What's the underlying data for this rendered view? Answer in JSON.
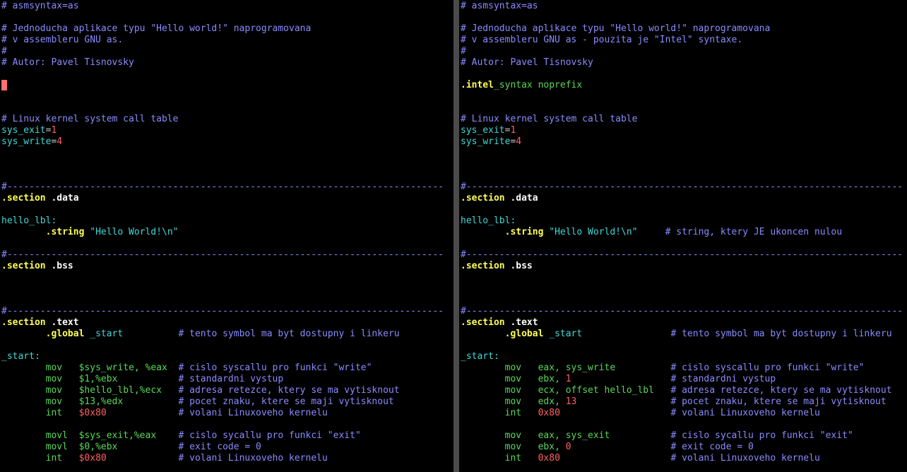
{
  "editor": {
    "left_pane": {
      "lines": [
        [
          [
            "c-comment",
            "# asmsyntax=as"
          ]
        ],
        [],
        [
          [
            "c-comment",
            "# Jednoducha aplikace typu \"Hello world!\" naprogramovana"
          ]
        ],
        [
          [
            "c-comment",
            "# v assembleru GNU as."
          ]
        ],
        [
          [
            "c-comment",
            "#"
          ]
        ],
        [
          [
            "c-comment",
            "# Autor: Pavel Tisnovsky"
          ]
        ],
        [],
        "CURSOR",
        [],
        [],
        [
          [
            "c-comment",
            "# Linux kernel system call table"
          ]
        ],
        [
          [
            "c-label",
            "sys_exit"
          ],
          [
            "c-plain",
            "="
          ],
          [
            "c-number",
            "1"
          ]
        ],
        [
          [
            "c-label",
            "sys_write"
          ],
          [
            "c-plain",
            "="
          ],
          [
            "c-number",
            "4"
          ]
        ],
        [],
        [],
        [],
        [
          [
            "c-comment",
            "#-------------------------------------------------------------------------------"
          ]
        ],
        [
          [
            "c-directive",
            ".section"
          ],
          [
            "c-dirrest",
            " .data"
          ]
        ],
        [],
        [
          [
            "c-label",
            "hello_lbl:"
          ]
        ],
        [
          [
            "c-plain",
            "        "
          ],
          [
            "c-directive",
            ".string"
          ],
          [
            "c-plain",
            " "
          ],
          [
            "c-string",
            "\"Hello World!\\n\""
          ]
        ],
        [],
        [
          [
            "c-comment",
            "#-------------------------------------------------------------------------------"
          ]
        ],
        [
          [
            "c-directive",
            ".section"
          ],
          [
            "c-dirrest",
            " .bss"
          ]
        ],
        [],
        [],
        [],
        [
          [
            "c-comment",
            "#-------------------------------------------------------------------------------"
          ]
        ],
        [
          [
            "c-directive",
            ".section"
          ],
          [
            "c-dirrest",
            " .text"
          ]
        ],
        [
          [
            "c-plain",
            "        "
          ],
          [
            "c-directive",
            ".global"
          ],
          [
            "c-plain",
            " "
          ],
          [
            "c-ident",
            "_start"
          ],
          [
            "c-plain",
            "          "
          ],
          [
            "c-comment",
            "# tento symbol ma byt dostupny i linkeru"
          ]
        ],
        [],
        [
          [
            "c-label",
            "_start:"
          ]
        ],
        [
          [
            "c-plain",
            "        "
          ],
          [
            "c-instr",
            "mov"
          ],
          [
            "c-plain",
            "   "
          ],
          [
            "c-operand",
            "$sys_write, %eax"
          ],
          [
            "c-plain",
            "  "
          ],
          [
            "c-comment",
            "# cislo syscallu pro funkci \"write\""
          ]
        ],
        [
          [
            "c-plain",
            "        "
          ],
          [
            "c-instr",
            "mov"
          ],
          [
            "c-plain",
            "   "
          ],
          [
            "c-operand",
            "$1,%ebx"
          ],
          [
            "c-plain",
            "           "
          ],
          [
            "c-comment",
            "# standardni vystup"
          ]
        ],
        [
          [
            "c-plain",
            "        "
          ],
          [
            "c-instr",
            "mov"
          ],
          [
            "c-plain",
            "   "
          ],
          [
            "c-operand",
            "$hello_lbl,%ecx"
          ],
          [
            "c-plain",
            "   "
          ],
          [
            "c-comment",
            "# adresa retezce, ktery se ma vytisknout"
          ]
        ],
        [
          [
            "c-plain",
            "        "
          ],
          [
            "c-instr",
            "mov"
          ],
          [
            "c-plain",
            "   "
          ],
          [
            "c-operand",
            "$13,%edx"
          ],
          [
            "c-plain",
            "          "
          ],
          [
            "c-comment",
            "# pocet znaku, ktere se maji vytisknout"
          ]
        ],
        [
          [
            "c-plain",
            "        "
          ],
          [
            "c-instr",
            "int"
          ],
          [
            "c-plain",
            "   "
          ],
          [
            "c-imm",
            "$0x80"
          ],
          [
            "c-plain",
            "             "
          ],
          [
            "c-comment",
            "# volani Linuxoveho kernelu"
          ]
        ],
        [],
        [
          [
            "c-plain",
            "        "
          ],
          [
            "c-instr",
            "movl"
          ],
          [
            "c-plain",
            "  "
          ],
          [
            "c-operand",
            "$sys_exit,%eax"
          ],
          [
            "c-plain",
            "    "
          ],
          [
            "c-comment",
            "# cislo sycallu pro funkci \"exit\""
          ]
        ],
        [
          [
            "c-plain",
            "        "
          ],
          [
            "c-instr",
            "movl"
          ],
          [
            "c-plain",
            "  "
          ],
          [
            "c-operand",
            "$0,%ebx"
          ],
          [
            "c-plain",
            "           "
          ],
          [
            "c-comment",
            "# exit code = 0"
          ]
        ],
        [
          [
            "c-plain",
            "        "
          ],
          [
            "c-instr",
            "int"
          ],
          [
            "c-plain",
            "   "
          ],
          [
            "c-imm",
            "$0x80"
          ],
          [
            "c-plain",
            "             "
          ],
          [
            "c-comment",
            "# volani Linuxoveho kernelu"
          ]
        ]
      ]
    },
    "right_pane": {
      "lines": [
        [
          [
            "c-comment",
            "# asmsyntax=as"
          ]
        ],
        [],
        [
          [
            "c-comment",
            "# Jednoducha aplikace typu \"Hello world!\" naprogramovana"
          ]
        ],
        [
          [
            "c-comment",
            "# v assembleru GNU as - pouzita je \"Intel\" syntaxe."
          ]
        ],
        [
          [
            "c-comment",
            "#"
          ]
        ],
        [
          [
            "c-comment",
            "# Autor: Pavel Tisnovsky"
          ]
        ],
        [],
        [
          [
            "c-directive",
            ".intel"
          ],
          [
            "c-instr",
            "_syntax noprefix"
          ]
        ],
        [],
        [],
        [
          [
            "c-comment",
            "# Linux kernel system call table"
          ]
        ],
        [
          [
            "c-label",
            "sys_exit"
          ],
          [
            "c-plain",
            "="
          ],
          [
            "c-number",
            "1"
          ]
        ],
        [
          [
            "c-label",
            "sys_write"
          ],
          [
            "c-plain",
            "="
          ],
          [
            "c-number",
            "4"
          ]
        ],
        [],
        [],
        [],
        [
          [
            "c-comment",
            "#-------------------------------------------------------------------------------"
          ]
        ],
        [
          [
            "c-directive",
            ".section"
          ],
          [
            "c-dirrest",
            " .data"
          ]
        ],
        [],
        [
          [
            "c-label",
            "hello_lbl:"
          ]
        ],
        [
          [
            "c-plain",
            "        "
          ],
          [
            "c-directive",
            ".string"
          ],
          [
            "c-plain",
            " "
          ],
          [
            "c-string",
            "\"Hello World!\\n\""
          ],
          [
            "c-plain",
            "     "
          ],
          [
            "c-comment",
            "# string, ktery JE ukoncen nulou"
          ]
        ],
        [],
        [
          [
            "c-comment",
            "#-------------------------------------------------------------------------------"
          ]
        ],
        [
          [
            "c-directive",
            ".section"
          ],
          [
            "c-dirrest",
            " .bss"
          ]
        ],
        [],
        [],
        [],
        [
          [
            "c-comment",
            "#-------------------------------------------------------------------------------"
          ]
        ],
        [
          [
            "c-directive",
            ".section"
          ],
          [
            "c-dirrest",
            " .text"
          ]
        ],
        [
          [
            "c-plain",
            "        "
          ],
          [
            "c-directive",
            ".global"
          ],
          [
            "c-plain",
            " "
          ],
          [
            "c-ident",
            "_start"
          ],
          [
            "c-plain",
            "                "
          ],
          [
            "c-comment",
            "# tento symbol ma byt dostupny i linkeru"
          ]
        ],
        [],
        [
          [
            "c-label",
            "_start:"
          ]
        ],
        [
          [
            "c-plain",
            "        "
          ],
          [
            "c-instr",
            "mov"
          ],
          [
            "c-plain",
            "   "
          ],
          [
            "c-operand",
            "eax, sys_write"
          ],
          [
            "c-plain",
            "          "
          ],
          [
            "c-comment",
            "# cislo syscallu pro funkci \"write\""
          ]
        ],
        [
          [
            "c-plain",
            "        "
          ],
          [
            "c-instr",
            "mov"
          ],
          [
            "c-plain",
            "   "
          ],
          [
            "c-operand",
            "ebx, "
          ],
          [
            "c-imm",
            "1"
          ],
          [
            "c-plain",
            "                  "
          ],
          [
            "c-comment",
            "# standardni vystup"
          ]
        ],
        [
          [
            "c-plain",
            "        "
          ],
          [
            "c-instr",
            "mov"
          ],
          [
            "c-plain",
            "   "
          ],
          [
            "c-operand",
            "ecx, offset hello_lbl"
          ],
          [
            "c-plain",
            "   "
          ],
          [
            "c-comment",
            "# adresa retezce, ktery se ma vytisknout"
          ]
        ],
        [
          [
            "c-plain",
            "        "
          ],
          [
            "c-instr",
            "mov"
          ],
          [
            "c-plain",
            "   "
          ],
          [
            "c-operand",
            "edx, "
          ],
          [
            "c-imm",
            "13"
          ],
          [
            "c-plain",
            "                 "
          ],
          [
            "c-comment",
            "# pocet znaku, ktere se maji vytisknout"
          ]
        ],
        [
          [
            "c-plain",
            "        "
          ],
          [
            "c-instr",
            "int"
          ],
          [
            "c-plain",
            "   "
          ],
          [
            "c-imm",
            "0x80"
          ],
          [
            "c-plain",
            "                    "
          ],
          [
            "c-comment",
            "# volani Linuxoveho kernelu"
          ]
        ],
        [],
        [
          [
            "c-plain",
            "        "
          ],
          [
            "c-instr",
            "mov"
          ],
          [
            "c-plain",
            "   "
          ],
          [
            "c-operand",
            "eax, sys_exit"
          ],
          [
            "c-plain",
            "           "
          ],
          [
            "c-comment",
            "# cislo sycallu pro funkci \"exit\""
          ]
        ],
        [
          [
            "c-plain",
            "        "
          ],
          [
            "c-instr",
            "mov"
          ],
          [
            "c-plain",
            "   "
          ],
          [
            "c-operand",
            "ebx, "
          ],
          [
            "c-imm",
            "0"
          ],
          [
            "c-plain",
            "                  "
          ],
          [
            "c-comment",
            "# exit code = 0"
          ]
        ],
        [
          [
            "c-plain",
            "        "
          ],
          [
            "c-instr",
            "int"
          ],
          [
            "c-plain",
            "   "
          ],
          [
            "c-imm",
            "0x80"
          ],
          [
            "c-plain",
            "                    "
          ],
          [
            "c-comment",
            "# volani Linuxoveho kernelu"
          ]
        ]
      ]
    }
  },
  "colors": {
    "background": "#000000",
    "divider": "#4a4a4a",
    "comment": "#8a8aff",
    "label": "#40d8d8",
    "number": "#ff6060",
    "directive": "#ffff55",
    "instruction": "#58d858",
    "cursor": "#ff7070"
  }
}
